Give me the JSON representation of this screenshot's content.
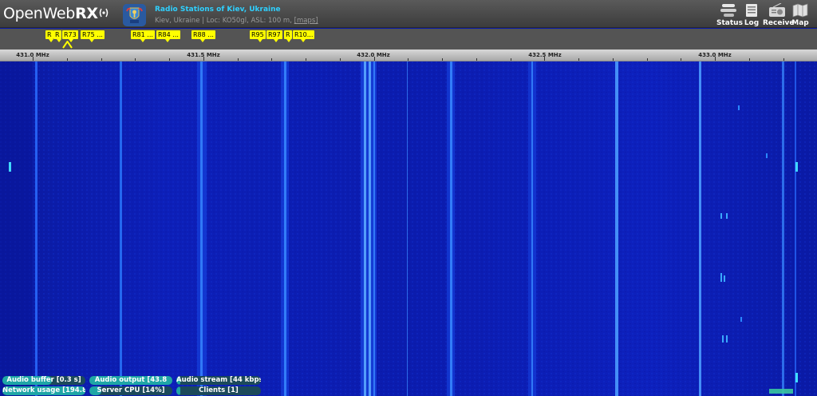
{
  "header": {
    "logo_text": "OpenWeb",
    "logo_rx": "RX",
    "receiver_title": "Radio Stations of Kiev, Ukraine",
    "receiver_desc": "Kiev, Ukraine | Loc: KO50gl, ASL: 100 m,",
    "receiver_maps": "[maps]",
    "nav": [
      {
        "label": "Status",
        "icon": "status-icon"
      },
      {
        "label": "Log",
        "icon": "log-icon"
      },
      {
        "label": "Receive",
        "icon": "radio-icon"
      },
      {
        "label": "Map",
        "icon": "map-icon"
      }
    ]
  },
  "bookmarks": [
    {
      "label": "R"
    },
    {
      "label": "R"
    },
    {
      "label": "R73"
    },
    {
      "label": "R75 ..."
    },
    {
      "label": "R81 ..."
    },
    {
      "label": "R84 ..."
    },
    {
      "label": "R88 ..."
    },
    {
      "label": "R95"
    },
    {
      "label": "R97"
    },
    {
      "label": "R"
    },
    {
      "label": "R10..."
    }
  ],
  "scale": {
    "labels": [
      "431.0 MHz",
      "431.5 MHz",
      "432.0 MHz",
      "432.5 MHz",
      "433.0 MHz"
    ]
  },
  "status": {
    "audio_buffer": {
      "label": "Audio buffer [0.3 s]",
      "level": 0.6
    },
    "audio_output": {
      "label": "Audio output [43.8",
      "level": 1.0
    },
    "audio_stream": {
      "label": "Audio stream [44 kbps]",
      "level": 0.03
    },
    "network": {
      "label": "Network usage [194.8",
      "level": 1.0
    },
    "server_cpu": {
      "label": "Server CPU [14%]",
      "level": 0.14
    },
    "clients": {
      "label": "Clients [1]",
      "level": 0.03
    }
  },
  "colors": {
    "waterfall_bg": "#0b1cae",
    "bookmark": "#ffff00",
    "title_cyan": "#2fd0ff",
    "status_fill": "#1fa6a6"
  }
}
